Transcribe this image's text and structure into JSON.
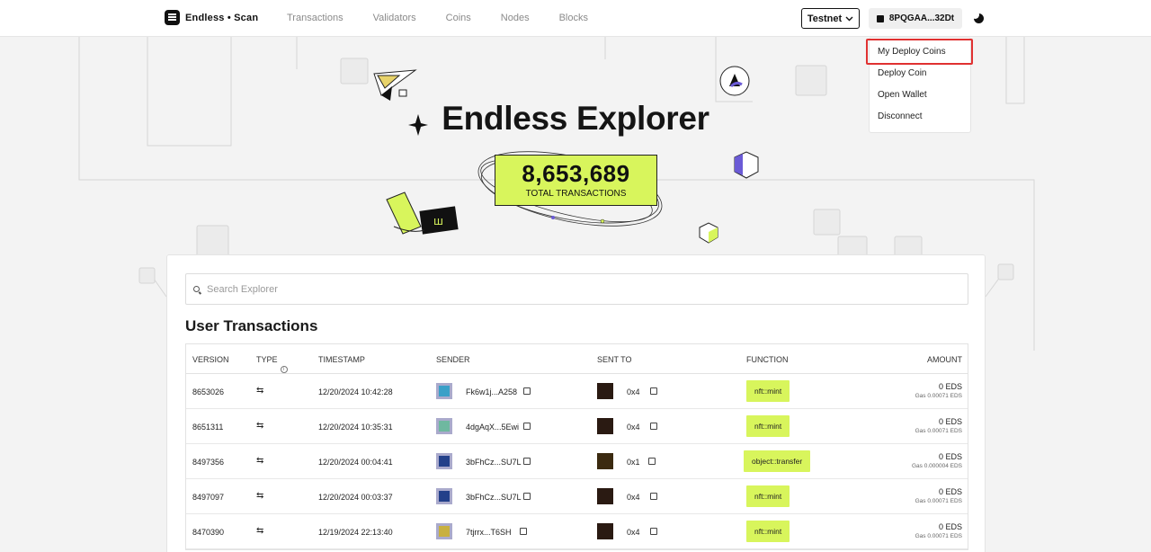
{
  "header": {
    "logo_text": "Endless • Scan",
    "nav": [
      "Transactions",
      "Validators",
      "Coins",
      "Nodes",
      "Blocks"
    ],
    "network_label": "Testnet",
    "wallet_label": "8PQGAA...32Dt"
  },
  "dropdown": {
    "items": [
      "My Deploy Coins",
      "Deploy Coin",
      "Open Wallet",
      "Disconnect"
    ]
  },
  "hero": {
    "title": "Endless Explorer",
    "tx_count": "8,653,689",
    "tx_label": "TOTAL TRANSACTIONS"
  },
  "search": {
    "placeholder": "Search Explorer"
  },
  "section_title": "User Transactions",
  "table": {
    "columns": [
      "VERSION",
      "TYPE",
      "TIMESTAMP",
      "SENDER",
      "SENT TO",
      "FUNCTION",
      "AMOUNT"
    ],
    "rows": [
      {
        "version": "8653026",
        "type": "⇆",
        "timestamp": "12/20/2024 10:42:28",
        "sender": "Fk6w1j...A258",
        "sent_to": "0x4",
        "function": "nft::mint",
        "amount": "0 EDS",
        "gas": "Gas 0.00071 EDS",
        "sender_color": "#3aa0c8",
        "to_color": "#2a1a12"
      },
      {
        "version": "8651311",
        "type": "⇆",
        "timestamp": "12/20/2024 10:35:31",
        "sender": "4dgAqX...5Ewi",
        "sent_to": "0x4",
        "function": "nft::mint",
        "amount": "0 EDS",
        "gas": "Gas 0.00071 EDS",
        "sender_color": "#6fb8a0",
        "to_color": "#2a1a12"
      },
      {
        "version": "8497356",
        "type": "⇆",
        "timestamp": "12/20/2024 00:04:41",
        "sender": "3bFhCz...SU7L",
        "sent_to": "0x1",
        "function": "object::transfer",
        "amount": "0 EDS",
        "gas": "Gas 0.000004 EDS",
        "sender_color": "#23408a",
        "to_color": "#3b2a10"
      },
      {
        "version": "8497097",
        "type": "⇆",
        "timestamp": "12/20/2024 00:03:37",
        "sender": "3bFhCz...SU7L",
        "sent_to": "0x4",
        "function": "nft::mint",
        "amount": "0 EDS",
        "gas": "Gas 0.00071 EDS",
        "sender_color": "#23408a",
        "to_color": "#2a1a12"
      },
      {
        "version": "8470390",
        "type": "⇆",
        "timestamp": "12/19/2024 22:13:40",
        "sender": "7tjrrx...T6SH",
        "sent_to": "0x4",
        "function": "nft::mint",
        "amount": "0 EDS",
        "gas": "Gas 0.00071 EDS",
        "sender_color": "#c8b040",
        "to_color": "#2a1a12"
      }
    ]
  },
  "colors": {
    "accent": "#d8f55c",
    "highlight": "#e03131"
  }
}
